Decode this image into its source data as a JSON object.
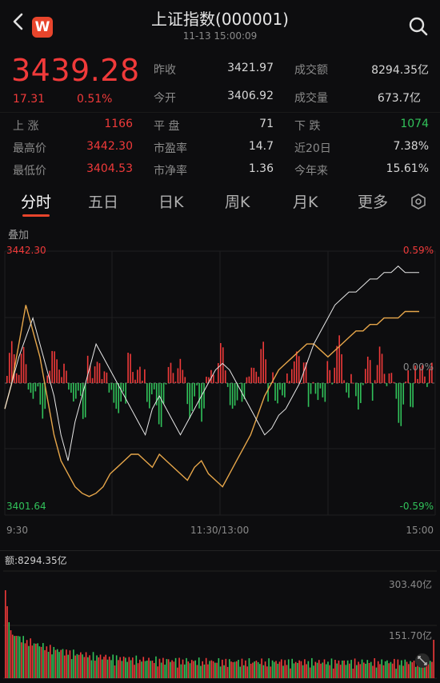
{
  "header": {
    "title": "上证指数(000001)",
    "timestamp": "11-13 15:00:09",
    "logo_text": "W",
    "back_icon": "chevron-left-icon",
    "search_icon": "search-icon"
  },
  "quote": {
    "price": "3439.28",
    "change": "17.31",
    "change_pct": "0.51%"
  },
  "stats": {
    "prev_close_label": "昨收",
    "prev_close": "3421.97",
    "turnover_label": "成交额",
    "turnover": "8294.35亿",
    "open_label": "今开",
    "open": "3406.92",
    "volume_label": "成交量",
    "volume": "673.7亿",
    "up_label": "上 涨",
    "up": "1166",
    "flat_label": "平 盘",
    "flat": "71",
    "down_label": "下 跌",
    "down": "1074",
    "high_label": "最高价",
    "high": "3442.30",
    "pe_label": "市盈率",
    "pe": "14.7",
    "d20_label": "近20日",
    "d20": "7.38%",
    "low_label": "最低价",
    "low": "3404.53",
    "pb_label": "市净率",
    "pb": "1.36",
    "ytd_label": "今年来",
    "ytd": "15.61%"
  },
  "tabs": [
    {
      "label": "分时",
      "active": true
    },
    {
      "label": "五日"
    },
    {
      "label": "日K"
    },
    {
      "label": "周K"
    },
    {
      "label": "月K"
    },
    {
      "label": "更多"
    }
  ],
  "overlay_label": "叠加",
  "chart": {
    "top_price": "3442.30",
    "top_pct": "0.59%",
    "mid_pct": "0.00%",
    "bottom_price": "3401.64",
    "bottom_pct": "-0.59%",
    "time_start": "9:30",
    "time_mid": "11:30/13:00",
    "time_end": "15:00"
  },
  "volume_panel": {
    "label": "额:8294.35亿",
    "top_value": "303.40亿",
    "mid_value": "151.70亿"
  },
  "colors": {
    "up": "#f03a3a",
    "down": "#31c25a",
    "price_line": "#e8e8e8",
    "avg_line": "#e6a64a",
    "accent": "#e8452c"
  },
  "chart_data": {
    "type": "line",
    "ylim": [
      3401.64,
      3442.3
    ],
    "prev_close": 3421.97,
    "series": [
      {
        "values": [
          3418,
          3422,
          3426,
          3429,
          3432,
          3428,
          3424,
          3420,
          3414,
          3410,
          3416,
          3420,
          3424,
          3428,
          3426,
          3424,
          3422,
          3420,
          3418,
          3416,
          3414,
          3418,
          3420,
          3418,
          3416,
          3414,
          3416,
          3418,
          3420,
          3422,
          3424,
          3425,
          3424,
          3422,
          3420,
          3418,
          3416,
          3414,
          3415,
          3417,
          3418,
          3420,
          3422,
          3425,
          3428,
          3430,
          3432,
          3434,
          3435,
          3436,
          3436,
          3437,
          3438,
          3438,
          3439,
          3439,
          3440,
          3439,
          3439,
          3439
        ]
      },
      {
        "values": [
          3418,
          3422,
          3428,
          3434,
          3430,
          3426,
          3420,
          3414,
          3410,
          3408,
          3406,
          3405,
          3404.5,
          3405,
          3406,
          3408,
          3409,
          3410,
          3411,
          3411,
          3410,
          3409,
          3411,
          3410,
          3409,
          3408,
          3407,
          3409,
          3410,
          3408,
          3407,
          3406,
          3408,
          3410,
          3412,
          3414,
          3417,
          3420,
          3422,
          3424,
          3425,
          3426,
          3427,
          3428,
          3428,
          3427,
          3426,
          3427,
          3428,
          3429,
          3430,
          3430,
          3431,
          3431,
          3432,
          3432,
          3432,
          3433,
          3433,
          3433
        ]
      }
    ]
  }
}
